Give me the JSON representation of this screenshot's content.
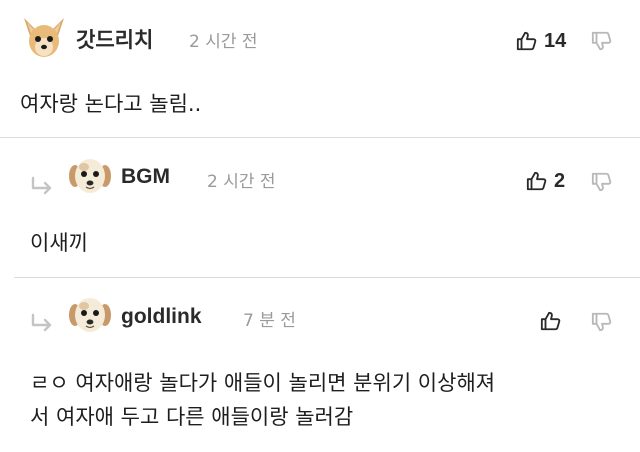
{
  "colors": {
    "username": "#2a2a2a",
    "timestamp": "#9a9a9a",
    "divider": "#dcdcdc",
    "icon_gray": "#b8b8b8",
    "icon_dark": "#2a2a2a"
  },
  "comments": [
    {
      "username": "갓드리치",
      "timestamp": "2 시간 전",
      "text_lines": [
        "여자랑 논다고 놀림.."
      ],
      "likes": "14",
      "is_reply": false,
      "avatar_icon": "chihuahua-avatar-icon"
    },
    {
      "username": "BGM",
      "timestamp": "2 시간 전",
      "text_lines": [
        "이새끼"
      ],
      "likes": "2",
      "is_reply": true,
      "avatar_icon": "puppy-avatar-icon"
    },
    {
      "username": "goldlink",
      "timestamp": "7 분 전",
      "text_lines": [
        "ㄹㅇ 여자애랑 놀다가 애들이 놀리면 분위기 이상해져",
        "서 여자애 두고 다른 애들이랑 놀러감"
      ],
      "likes": "",
      "is_reply": true,
      "avatar_icon": "puppy-avatar-icon"
    }
  ],
  "icons": {
    "like": "thumbs-up-icon",
    "dislike": "thumbs-down-icon",
    "reply": "reply-arrow-icon"
  }
}
